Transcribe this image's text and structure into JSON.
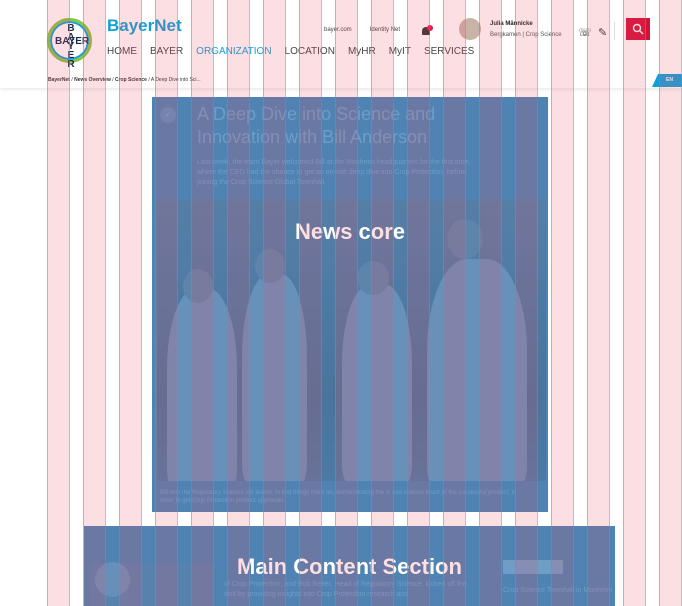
{
  "header": {
    "logo_vertical": "B\nA\nY\nE\nR",
    "logo_horizontal": "BAYER",
    "brand": "BayerNet",
    "nav": [
      "HOME",
      "BAYER",
      "ORGANIZATION",
      "LOCATION",
      "MyHR",
      "MyIT",
      "SERVICES"
    ],
    "active_nav": "ORGANIZATION",
    "top_links": [
      "bayer.com",
      "Identity Net"
    ],
    "user_name": "Julia Männicke",
    "user_location": "Bergkamen | Crop Science",
    "search_icon": "search-icon"
  },
  "breadcrumb": {
    "items": [
      "BayerNet",
      "News Overview",
      "Crop Science",
      "A Deep Dive into Sci..."
    ]
  },
  "lang": "EN",
  "news": {
    "title": "A Deep Dive into Science and Innovation with Bill Anderson",
    "lead": "Last week, the team Bayer welcomed Bill at the Monheim headquarters for the first time, where the CEO had the chance to get an on-site deep dive into Crop Protection, before joining the Crop Science Global Townhall.",
    "overlay_label": "News core",
    "caption": "Bill with the Regulatory Science lab teams, to find things more on, demonstrating the in use science much of the successful product, in order to get Crop Protection product approvals."
  },
  "main": {
    "overlay_label": "Main Content Section",
    "text": "of Crop Protection, and Bob Reiter, Head of Regulatory Science, kicked off the visit by providing insights into Crop Protection research and"
  },
  "side": {
    "text": "Crop Science Townhall in Monheim"
  },
  "colors": {
    "brand_blue": "#10a0d8",
    "brand_green": "#89c540",
    "search_red": "#d3123a",
    "overlay_blue": "#4e83b3"
  }
}
